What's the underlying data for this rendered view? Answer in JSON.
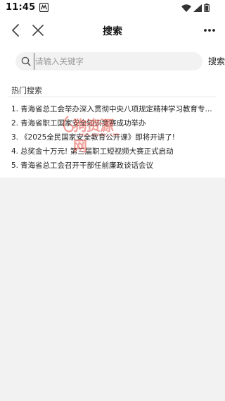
{
  "status_bar": {
    "time": "11:45",
    "notification_icon": "app-notification-icon",
    "icons": [
      "wifi-icon",
      "signal-icon",
      "battery-icon"
    ]
  },
  "nav": {
    "title": "搜索",
    "back_icon": "chevron-left-icon",
    "close_icon": "close-icon",
    "more_icon": "more-dots-icon"
  },
  "search": {
    "placeholder": "请输入关键字",
    "value": "",
    "button_label": "搜索"
  },
  "hot": {
    "title": "热门搜索",
    "items": [
      {
        "num": "1.",
        "text": "青海省总工会举办深入贯彻中央八项规定精神学习教育专..."
      },
      {
        "num": "2.",
        "text": "青海省职工国家安全知识竞赛成功举办"
      },
      {
        "num": "3.",
        "text": "《2025全民国家安全教育公开课》即将开讲了!"
      },
      {
        "num": "4.",
        "text": "总奖金十万元! 第三届职工短视频大赛正式启动"
      },
      {
        "num": "5.",
        "text": "青海省总工会召开干部任前廉政谈话会议"
      }
    ]
  },
  "watermark": {
    "text": "狗资源网",
    "sub": "www.gouzy.com"
  },
  "colors": {
    "page_bg": "#f2f2f2",
    "card_bg": "#ffffff",
    "search_bg": "#f2f2f2",
    "watermark": "#e23b2e"
  }
}
